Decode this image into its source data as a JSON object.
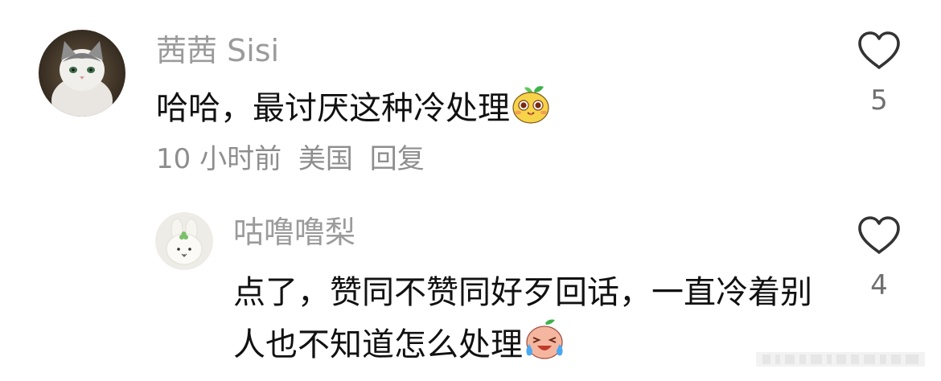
{
  "comments": [
    {
      "author": "茜茜 Sisi",
      "text": "哈哈，最讨厌这种冷处理",
      "emoji": "sprout-face-emoji",
      "time": "10 小时前",
      "location": "美国",
      "reply_label": "回复",
      "likes": "5",
      "avatar": "cat-avatar"
    },
    {
      "author": "咕噜噜梨",
      "text": "点了，赞同不赞同好歹回话，一直冷着别人也不知道怎么处理",
      "emoji": "crying-face-emoji",
      "likes": "4",
      "avatar": "bunny-avatar"
    }
  ],
  "icons": {
    "like": "heart-outline-icon"
  },
  "colors": {
    "author": "#9b9b9b",
    "text": "#111111",
    "meta": "#8e8e8e",
    "heart": "#333333"
  }
}
